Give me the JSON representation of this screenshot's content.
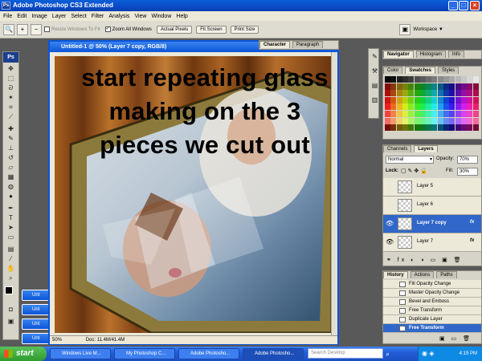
{
  "window": {
    "title": "Adobe Photoshop CS3 Extended",
    "icon": "ps-icon"
  },
  "menu": [
    "File",
    "Edit",
    "Image",
    "Layer",
    "Select",
    "Filter",
    "Analysis",
    "View",
    "Window",
    "Help"
  ],
  "options": {
    "resize_windows": "Resize Windows To Fit",
    "zoom_all": "Zoom All Windows",
    "actual_pixels": "Actual Pixels",
    "fit_screen": "Fit Screen",
    "print_size": "Print Size",
    "workspace": "Workspace ▼"
  },
  "toolbox": {
    "logo": "Ps"
  },
  "document": {
    "title": "Untitled-1 @ 50% (Layer 7 copy, RGB/8)",
    "zoom": "50%",
    "doc_info": "Doc: 11.4M/41.4M"
  },
  "caption": {
    "line1": "start repeating glass",
    "line2": "making on the 3",
    "line3": "pieces we cut out"
  },
  "char_panel": {
    "tabs": [
      "Character",
      "Paragraph"
    ]
  },
  "nav_panel": {
    "tabs": [
      "Navigator",
      "Histogram",
      "Info"
    ]
  },
  "swatch_panel": {
    "tabs": [
      "Color",
      "Swatches",
      "Styles"
    ]
  },
  "layers_panel": {
    "tabs": [
      "Channels",
      "Layers"
    ],
    "blend_mode": "Normal",
    "opacity_label": "Opacity:",
    "opacity": "70%",
    "lock_label": "Lock:",
    "fill_label": "Fill:",
    "fill": "30%",
    "layers": [
      {
        "name": "Layer 5",
        "visible": false,
        "selected": false
      },
      {
        "name": "Layer 6",
        "visible": false,
        "selected": false
      },
      {
        "name": "Layer 7 copy",
        "visible": true,
        "selected": true
      },
      {
        "name": "Layer 7",
        "visible": true,
        "selected": false
      }
    ]
  },
  "history_panel": {
    "tabs": [
      "History",
      "Actions",
      "Paths"
    ],
    "items": [
      "Fill Opacity Change",
      "Master Opacity Change",
      "Bevel and Emboss",
      "Free Transform",
      "Duplicate Layer",
      "Free Transform"
    ]
  },
  "minimized_docs": [
    "Unt",
    "Unt",
    "Unt",
    "Unt"
  ],
  "taskbar": {
    "start": "start",
    "tasks": [
      "Windows Live M...",
      "My Photoshop C...",
      "Adobe Photosho...",
      "Adobe Photosho..."
    ],
    "search_placeholder": "Search Desktop",
    "time": "4:19 PM"
  },
  "colors": {
    "xp_blue": "#0a55d8",
    "selection": "#3167c9",
    "panel": "#d6d3c8"
  }
}
